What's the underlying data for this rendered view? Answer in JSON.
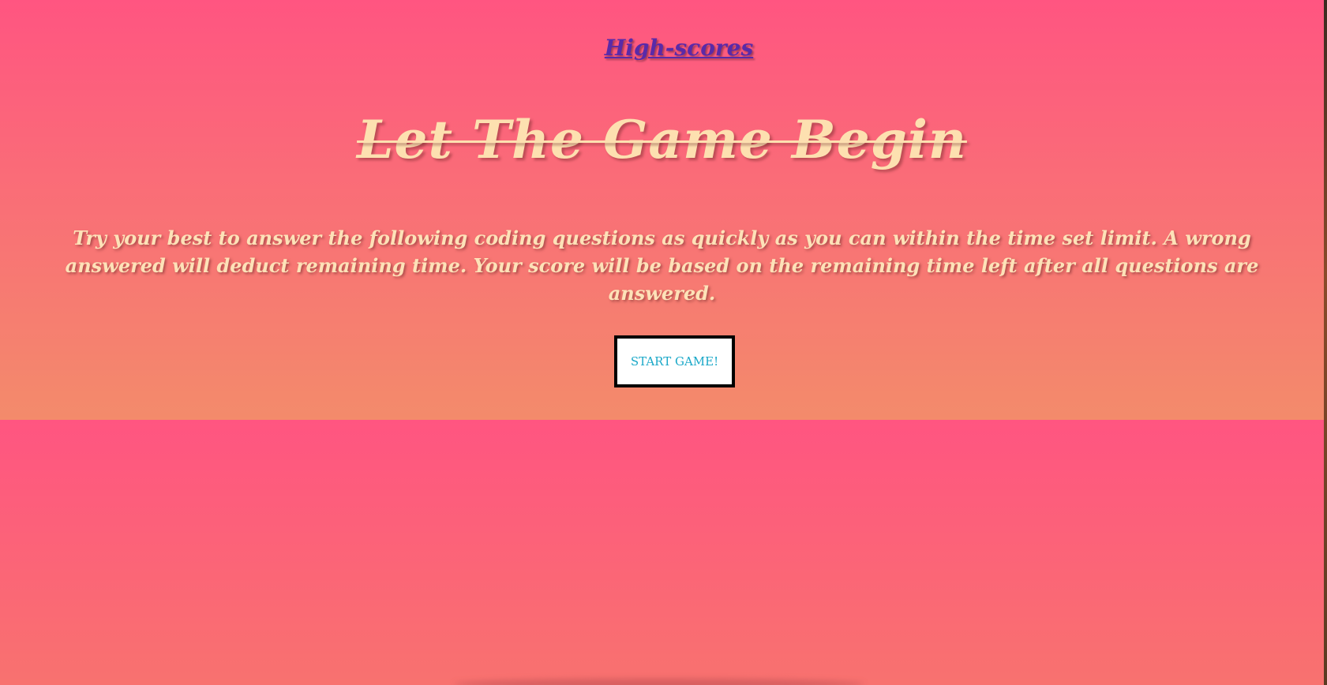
{
  "nav": {
    "highscores_label": "High-scores"
  },
  "hero": {
    "title": "Let The Game Begin",
    "instructions": "Try your best to answer the following coding questions as quickly as you can within the time set limit. A wrong answered will deduct remaining time. Your score will be based on the remaining time left after all questions are answered.",
    "start_label": "START GAME!"
  },
  "colors": {
    "background_top": "#ff5581",
    "background_bottom": "#f38b6b",
    "title_text": "#fde0b0",
    "link_text": "#5a2aa8",
    "button_text": "#1aa8c8",
    "button_border": "#000000",
    "button_bg": "#ffffff"
  }
}
